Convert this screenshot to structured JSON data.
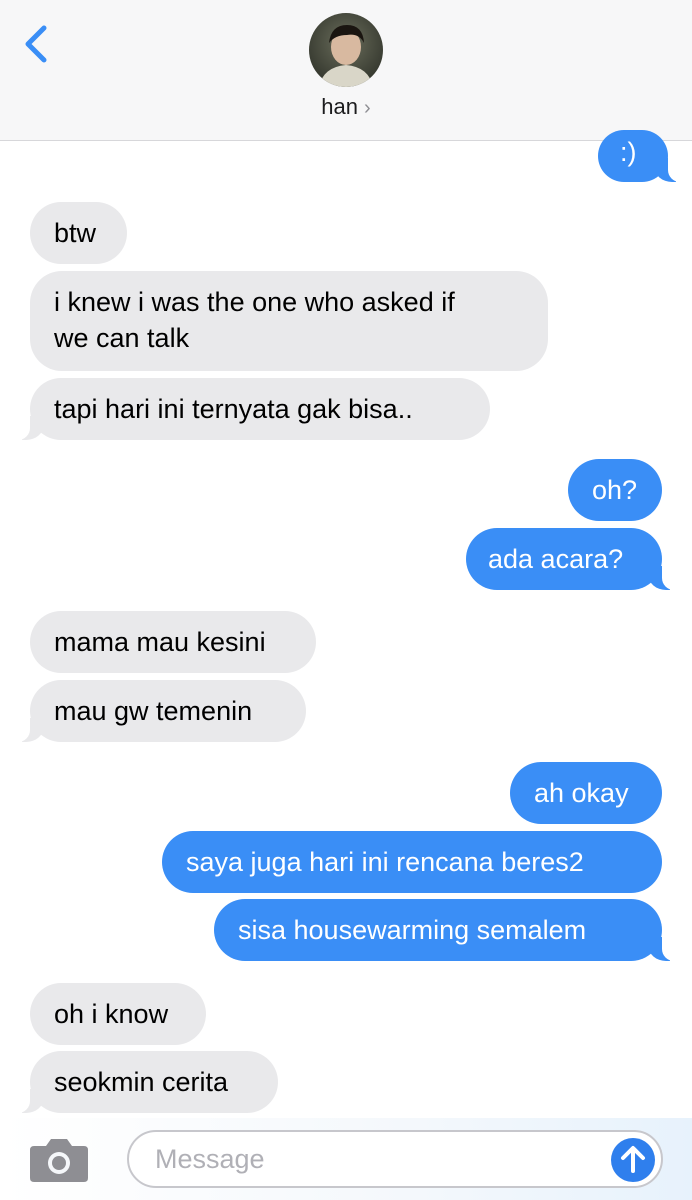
{
  "header": {
    "contact_name": "han",
    "chevron": "›",
    "back_icon": "chevron-left-icon",
    "accent_color": "#3a8ef6"
  },
  "messages": [
    {
      "side": "out",
      "text": ":)"
    },
    {
      "side": "in",
      "text": "btw"
    },
    {
      "side": "in",
      "lines": [
        "i knew i was the one who asked if",
        "we can talk"
      ]
    },
    {
      "side": "in",
      "text": "tapi hari ini ternyata gak bisa.."
    },
    {
      "side": "out",
      "text": "oh?"
    },
    {
      "side": "out",
      "text": "ada acara?"
    },
    {
      "side": "in",
      "text": "mama mau kesini"
    },
    {
      "side": "in",
      "text": "mau gw temenin"
    },
    {
      "side": "out",
      "text": "ah okay"
    },
    {
      "side": "out",
      "text": "saya juga hari ini rencana beres2"
    },
    {
      "side": "out",
      "text": "sisa housewarming semalem"
    },
    {
      "side": "in",
      "text": "oh i know"
    },
    {
      "side": "in",
      "text": "seokmin cerita"
    }
  ],
  "composer": {
    "placeholder": "Message",
    "camera_icon": "camera-icon",
    "send_icon": "send-arrow-up-icon"
  }
}
